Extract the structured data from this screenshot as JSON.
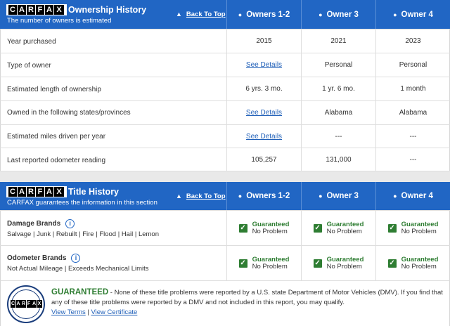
{
  "ownership": {
    "logo": "CARFAX",
    "title": "Ownership History",
    "subtitle": "The number of owners is estimated",
    "back_to_top": "Back To Top",
    "columns": [
      "Owners 1-2",
      "Owner 3",
      "Owner 4"
    ],
    "rows": [
      {
        "label": "Year purchased",
        "values": [
          "2015",
          "2021",
          "2023"
        ]
      },
      {
        "label": "Type of owner",
        "values": [
          "See Details",
          "Personal",
          "Personal"
        ]
      },
      {
        "label": "Estimated length of ownership",
        "values": [
          "6 yrs. 3 mo.",
          "1 yr. 6 mo.",
          "1 month"
        ]
      },
      {
        "label": "Owned in the following states/provinces",
        "values": [
          "See Details",
          "Alabama",
          "Alabama"
        ]
      },
      {
        "label": "Estimated miles driven per year",
        "values": [
          "See Details",
          "---",
          "---"
        ]
      },
      {
        "label": "Last reported odometer reading",
        "values": [
          "105,257",
          "131,000",
          "---"
        ]
      }
    ]
  },
  "title_history": {
    "logo": "CARFAX",
    "title": "Title History",
    "subtitle": "CARFAX guarantees the information in this section",
    "back_to_top": "Back To Top",
    "columns": [
      "Owners 1-2",
      "Owner 3",
      "Owner 4"
    ],
    "brands": [
      {
        "title": "Damage Brands",
        "detail": "Salvage | Junk | Rebuilt | Fire | Flood | Hail | Lemon",
        "status_line1": "Guaranteed",
        "status_line2": "No Problem"
      },
      {
        "title": "Odometer Brands",
        "detail": "Not Actual Mileage | Exceeds Mechanical Limits",
        "status_line1": "Guaranteed",
        "status_line2": "No Problem"
      }
    ]
  },
  "guarantee": {
    "badge_text": "CARFAX",
    "heading": "GUARANTEED",
    "text": " - None of these title problems were reported by a U.S. state Department of Motor Vehicles (DMV). If you find that any of these title problems were reported by a DMV and not included in this report, you may qualify.",
    "view_terms": "View Terms",
    "separator": " | ",
    "view_certificate": "View Certificate"
  },
  "colors": {
    "header_blue": "#2166c4",
    "check_green": "#2e7d32",
    "link_blue": "#1f5fb8"
  },
  "icons": [
    "person-icon",
    "chevron-up-icon",
    "info-icon",
    "checkbox-check-icon",
    "carfax-buyback-badge"
  ]
}
